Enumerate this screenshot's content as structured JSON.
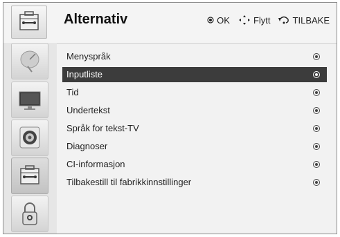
{
  "header": {
    "title": "Alternativ",
    "ok_label": "OK",
    "move_label": "Flytt",
    "back_label": "TILBAKE"
  },
  "sidebar": {
    "icons": [
      "satellite-dish-icon",
      "tv-screen-icon",
      "speaker-icon",
      "toolbox-icon",
      "padlock-icon"
    ],
    "active_index": 3
  },
  "menu": {
    "selected_index": 1,
    "items": [
      {
        "label": "Menyspråk"
      },
      {
        "label": "Inputliste"
      },
      {
        "label": "Tid"
      },
      {
        "label": "Undertekst"
      },
      {
        "label": "Språk for tekst-TV"
      },
      {
        "label": "Diagnoser"
      },
      {
        "label": "CI-informasjon"
      },
      {
        "label": "Tilbakestill til fabrikkinnstillinger"
      }
    ]
  },
  "colors": {
    "selected_row": "#3c3c3c",
    "background": "#f2f2f2"
  }
}
